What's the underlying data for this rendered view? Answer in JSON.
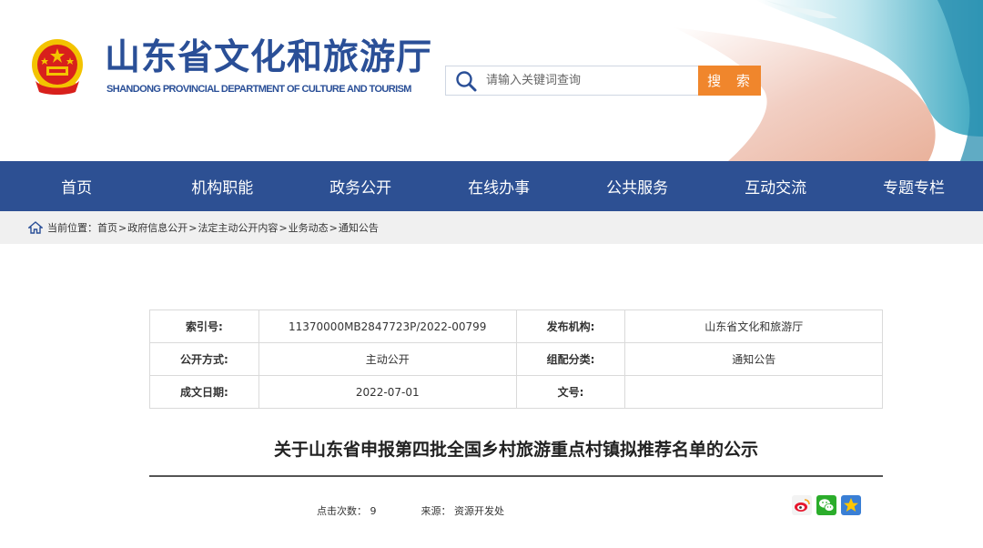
{
  "header": {
    "title": "山东省文化和旅游厅",
    "subtitle": "SHANDONG PROVINCIAL DEPARTMENT OF CULTURE AND TOURISM",
    "search_placeholder": "请输入关键词查询",
    "search_button": "搜 索"
  },
  "nav": {
    "items": [
      "首页",
      "机构职能",
      "政务公开",
      "在线办事",
      "公共服务",
      "互动交流",
      "专题专栏"
    ]
  },
  "breadcrumb": {
    "label": "当前位置：",
    "items": [
      "首页",
      "政府信息公开",
      "法定主动公开内容",
      "业务动态",
      "通知公告"
    ],
    "separator": ">"
  },
  "meta": {
    "rows": [
      {
        "k1": "索引号:",
        "v1": "11370000MB2847723P/2022-00799",
        "k2": "发布机构:",
        "v2": "山东省文化和旅游厅"
      },
      {
        "k1": "公开方式:",
        "v1": "主动公开",
        "k2": "组配分类:",
        "v2": "通知公告"
      },
      {
        "k1": "成文日期:",
        "v1": "2022-07-01",
        "k2": "文号:",
        "v2": ""
      }
    ]
  },
  "article": {
    "title": "关于山东省申报第四批全国乡村旅游重点村镇拟推荐名单的公示",
    "clicks_label": "点击次数：",
    "clicks": "9",
    "source_label": "来源：",
    "source": "资源开发处"
  },
  "share": {
    "icons": [
      "weibo-icon",
      "wechat-icon",
      "qzone-icon"
    ]
  },
  "colors": {
    "brand_blue": "#2d5093",
    "title_blue": "#2a4f97",
    "search_orange": "#f0862c"
  }
}
